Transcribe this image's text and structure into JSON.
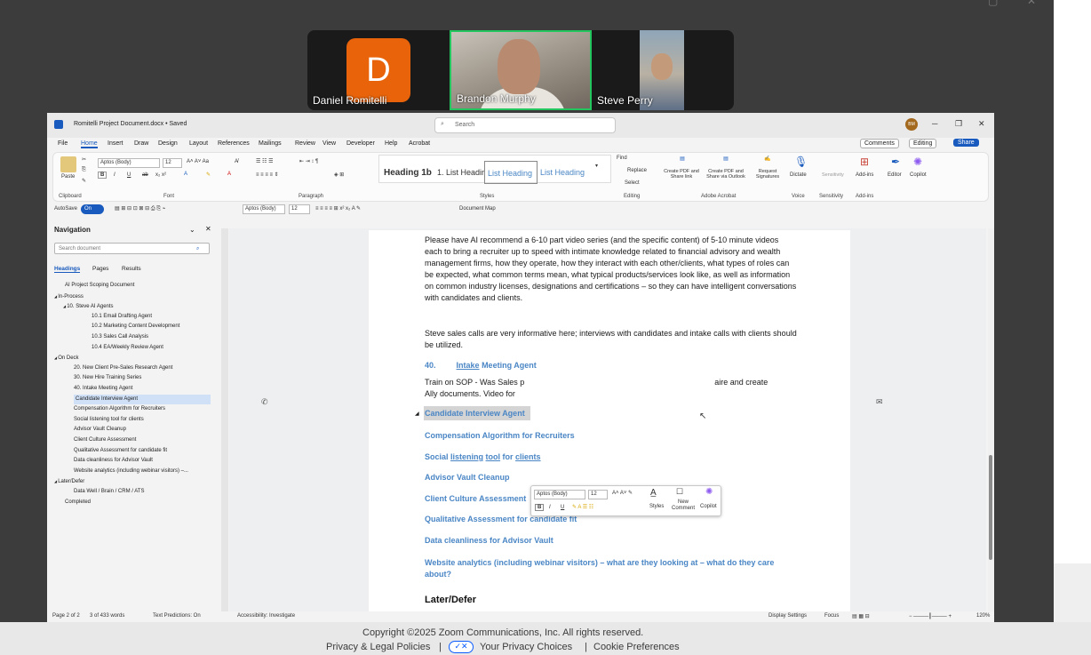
{
  "zoom": {
    "participants": [
      {
        "name": "Daniel Romitelli",
        "initial": "D"
      },
      {
        "name": "Brandon Murphy"
      },
      {
        "name": "Steve Perry"
      }
    ],
    "footer": {
      "copyright": "Copyright ©2025 Zoom Communications, Inc. All rights reserved.",
      "privacy_legal": "Privacy & Legal Policies",
      "privacy_choices": "Your Privacy Choices",
      "cookie": "Cookie Preferences"
    }
  },
  "word": {
    "doc_title": "Romitelli Project Document.docx  •  Saved",
    "search_placeholder": "Search",
    "user_initials": "BM",
    "tabs": [
      "File",
      "Home",
      "Insert",
      "Draw",
      "Design",
      "Layout",
      "References",
      "Mailings",
      "Review",
      "View",
      "Developer",
      "Help",
      "Acrobat"
    ],
    "active_tab": "Home",
    "top_buttons": {
      "comments": "Comments",
      "editing": "Editing",
      "share": "Share"
    },
    "ribbon": {
      "paste": "Paste",
      "font_name": "Aptos (Body)",
      "font_size": "12",
      "styles": [
        "Heading 1b",
        "1. List Headir",
        "List Heading",
        "List Heading"
      ],
      "find": "Find",
      "replace": "Replace",
      "select": "Select",
      "acrobat_btn1": "Create PDF and Share link",
      "acrobat_btn2": "Create PDF and Share via Outlook",
      "acrobat_btn3": "Request Signatures",
      "dictate": "Dictate",
      "sensitivity": "Sensitivity",
      "addins": "Add-ins",
      "editor": "Editor",
      "copilot": "Copilot",
      "groups": {
        "clipboard": "Clipboard",
        "font": "Font",
        "paragraph": "Paragraph",
        "styles": "Styles",
        "editing": "Editing",
        "acrobat": "Adobe Acrobat",
        "voice": "Voice",
        "sensitivity": "Sensitivity",
        "addins": "Add-ins"
      }
    },
    "qat": {
      "autosave": "AutoSave",
      "toggle": "On",
      "font_name": "Aptos (Body)",
      "font_size": "12",
      "document_map": "Document Map"
    },
    "navigation": {
      "title": "Navigation",
      "search_placeholder": "Search document",
      "tabs": [
        "Headings",
        "Pages",
        "Results"
      ],
      "items": [
        {
          "text": "AI Project Scoping Document",
          "indent": 0,
          "caret": false
        },
        {
          "text": "In-Process",
          "indent": 0,
          "caret": true
        },
        {
          "text": "10. Steve AI Agents",
          "indent": 1,
          "caret": true
        },
        {
          "text": "10.1  Email Drafting Agent",
          "indent": 2,
          "caret": false
        },
        {
          "text": "10.2  Marketing Content Development",
          "indent": 2,
          "caret": false
        },
        {
          "text": "10.3  Sales Call Analysis",
          "indent": 2,
          "caret": false
        },
        {
          "text": "10.4 EA/Weekly Review Agent",
          "indent": 2,
          "caret": false
        },
        {
          "text": "On Deck",
          "indent": 0,
          "caret": true
        },
        {
          "text": "20. New Client Pre-Sales Research Agent",
          "indent": 1,
          "caret": false
        },
        {
          "text": "30. New Hire Training Series",
          "indent": 1,
          "caret": false
        },
        {
          "text": "40. Intake Meeting Agent",
          "indent": 1,
          "caret": false
        },
        {
          "text": "Candidate Interview Agent",
          "indent": 1,
          "caret": false,
          "selected": true
        },
        {
          "text": "Compensation Algorithm for Recruiters",
          "indent": 1,
          "caret": false
        },
        {
          "text": "Social listening tool for clients",
          "indent": 1,
          "caret": false
        },
        {
          "text": "Advisor Vault Cleanup",
          "indent": 1,
          "caret": false
        },
        {
          "text": "Client Culture Assessment",
          "indent": 1,
          "caret": false
        },
        {
          "text": "Qualitative Assessment for candidate fit",
          "indent": 1,
          "caret": false
        },
        {
          "text": "Data cleanliness for Advisor Vault",
          "indent": 1,
          "caret": false
        },
        {
          "text": "Website analytics (including webinar visitors) –...",
          "indent": 1,
          "caret": false
        },
        {
          "text": "Later/Defer",
          "indent": 0,
          "caret": true
        },
        {
          "text": "Data Well / Brain / CRM / ATS",
          "indent": 1,
          "caret": false
        },
        {
          "text": "Completed",
          "indent": 0,
          "caret": false
        }
      ]
    },
    "page": {
      "p1": "Please have AI recommend a 6-10 part video series (and the specific content) of 5-10 minute videos each to bring a recruiter up to speed with intimate knowledge related to financial advisory and wealth management firms, how they operate, how they interact with each other/clients, what types of roles can be expected, what common terms mean, what typical products/services look like, as well as information on common industry licenses, designations and certifications – so they can have intelligent conversations with candidates and clients.",
      "p2": "Steve sales calls are very informative here; interviews with candidates and intake calls with clients should be utilized.",
      "h_intake_num": "40.",
      "h_intake_word": "Intake",
      "h_intake_rest": " Meeting Agent",
      "p3_left": "Train on SOP - Was Sales p",
      "p3_right": "aire and create",
      "p3_line2": "Ally documents. Video for",
      "h_candidate": "Candidate Interview Agent",
      "h_comp": "Compensation Algorithm for Recruiters",
      "h_social_1": "Social ",
      "h_social_2": "listening",
      "h_social_3": " ",
      "h_social_4": "tool",
      "h_social_5": " for ",
      "h_social_6": "clients",
      "h_vault": "Advisor Vault Cleanup",
      "h_culture": "Client Culture Assessment",
      "h_qual": "Qualitative Assessment for candidate fit",
      "h_data": "Data cleanliness for Advisor Vault",
      "h_web": "Website analytics (including webinar visitors) – what are they looking at – what do they care about?",
      "h_later": "Later/Defer"
    },
    "popup": {
      "font_name": "Aptos (Body)",
      "font_size": "12",
      "styles": "Styles",
      "new_comment": "New Comment",
      "copilot": "Copilot"
    },
    "status": {
      "page": "Page 2 of 2",
      "words": "3 of 433 words",
      "predictions": "Text Predictions: On",
      "accessibility": "Accessibility: Investigate",
      "display": "Display Settings",
      "focus": "Focus",
      "zoom": "120%"
    }
  }
}
